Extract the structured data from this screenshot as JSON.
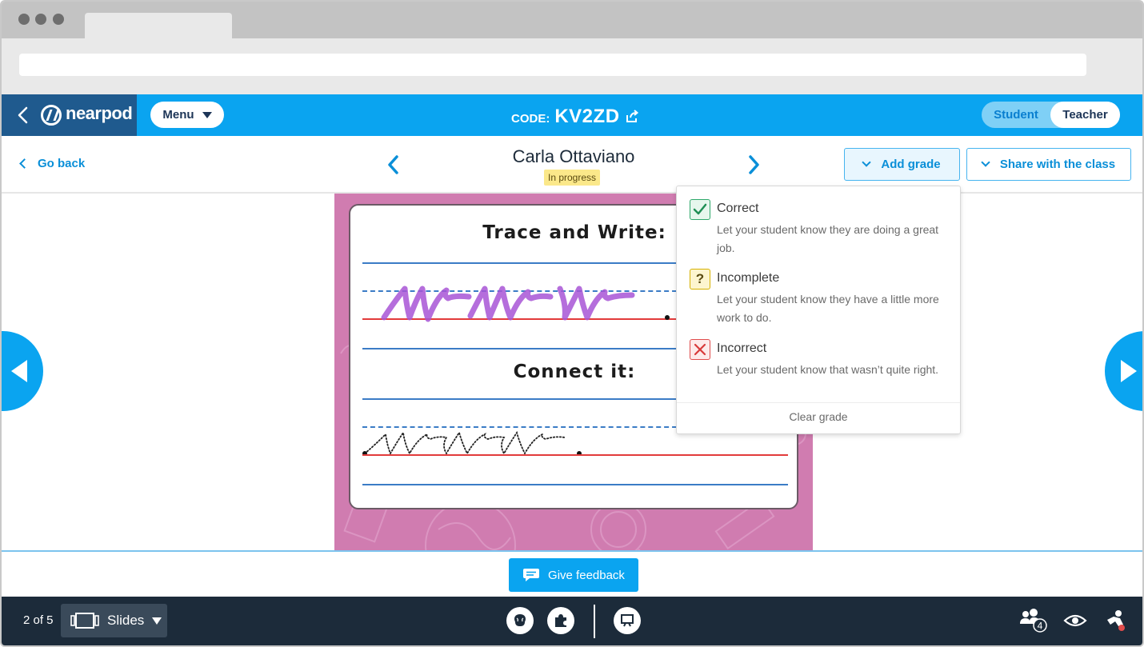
{
  "app": {
    "logo_text": "nearpod",
    "menu_label": "Menu",
    "code_label": "CODE:",
    "code_value": "KV2ZD",
    "role_student": "Student",
    "role_teacher": "Teacher"
  },
  "subheader": {
    "go_back": "Go back",
    "student_name": "Carla Ottaviano",
    "status": "In progress",
    "add_grade": "Add grade",
    "share_with_class": "Share with the class"
  },
  "slide": {
    "heading_1": "Trace and Write:",
    "heading_2": "Connect it:"
  },
  "grade_menu": {
    "options": [
      {
        "title": "Correct",
        "description": "Let your student know they are doing a great job.",
        "icon": "check-icon"
      },
      {
        "title": "Incomplete",
        "description": "Let your student know they have a little more work to do.",
        "icon": "question-icon"
      },
      {
        "title": "Incorrect",
        "description": "Let your student know that wasn’t quite right.",
        "icon": "x-icon"
      }
    ],
    "clear": "Clear grade"
  },
  "feedback": {
    "give_feedback": "Give feedback"
  },
  "bottombar": {
    "slide_count": "2 of 5",
    "slides_label": "Slides",
    "participants_count": "4"
  },
  "colors": {
    "brand_blue": "#0aa4f0",
    "logo_navy": "#1f5a8e",
    "bottom_bar": "#1c2b3a",
    "slide_pink": "#d07cb0",
    "student_ink": "#a855d6"
  }
}
